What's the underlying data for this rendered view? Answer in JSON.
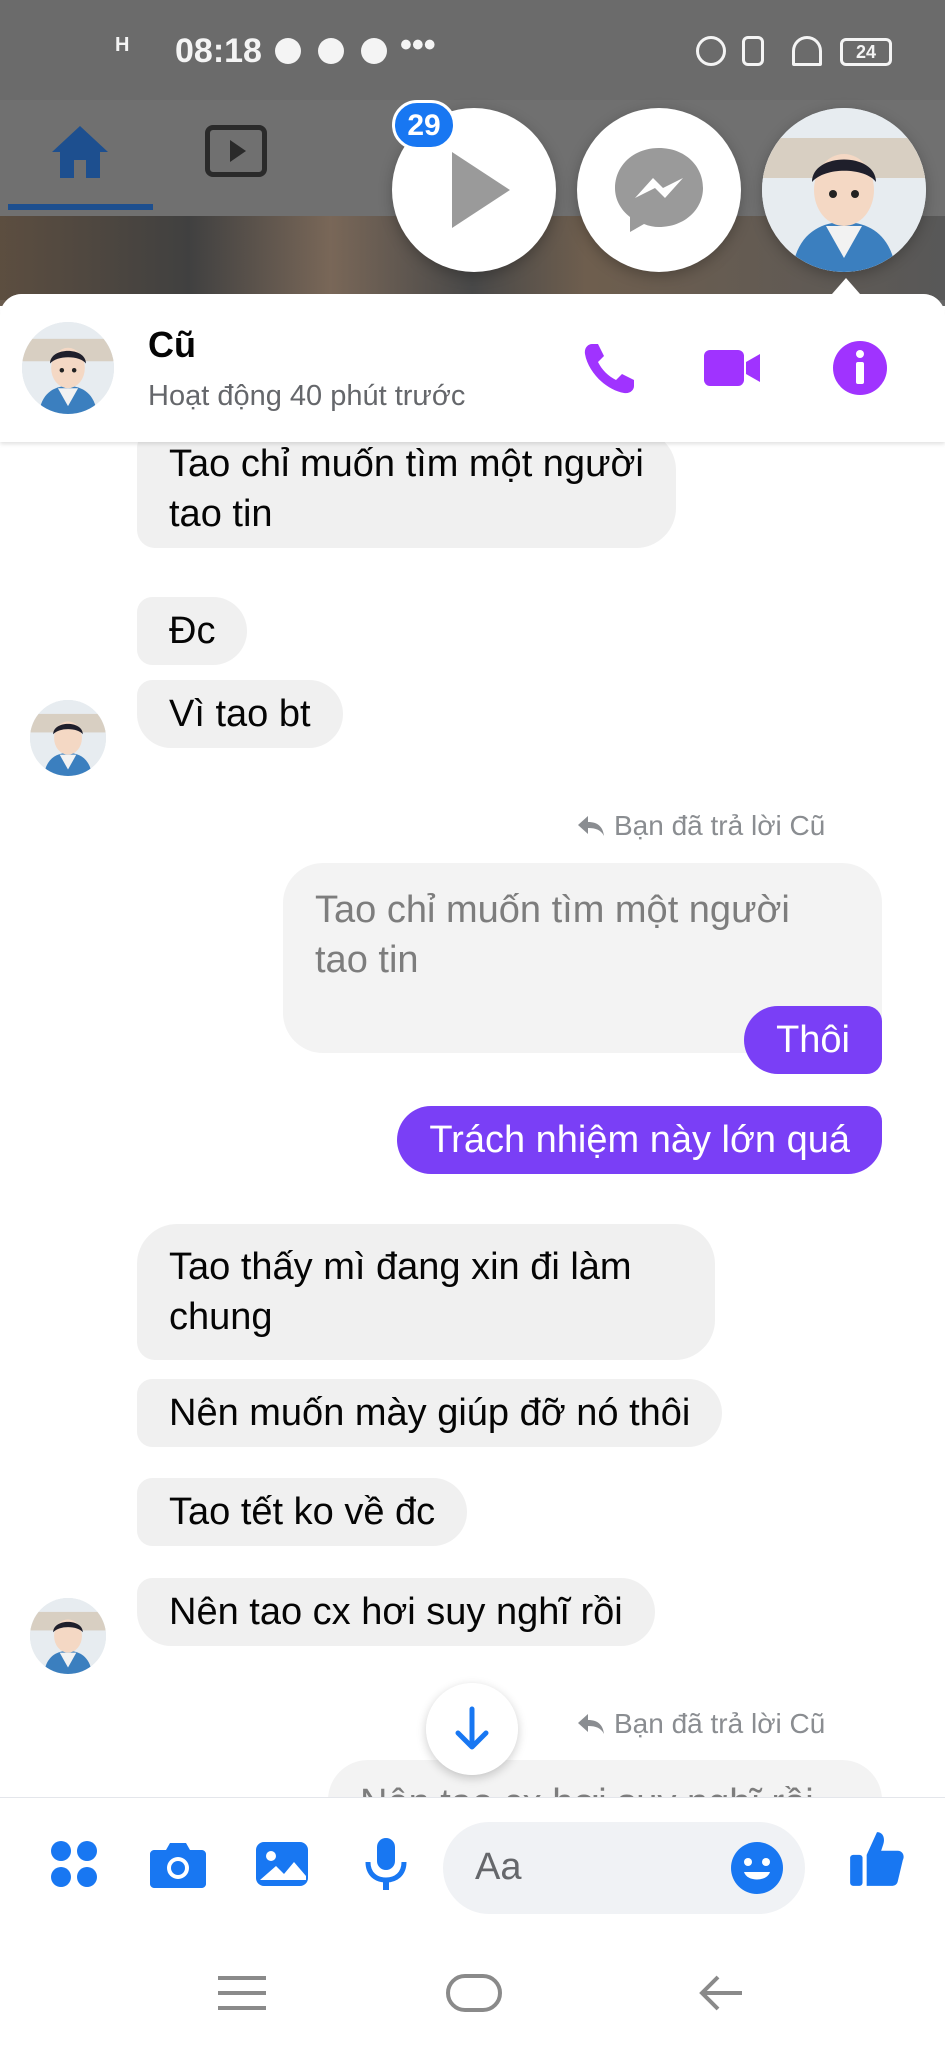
{
  "status_bar": {
    "network": "H",
    "time": "08:18",
    "more": "•••",
    "battery": "24"
  },
  "chat_heads": {
    "badge_count": "29"
  },
  "header": {
    "contact_name": "Cũ",
    "activity": "Hoạt động 40 phút trước"
  },
  "messages": [
    {
      "side": "in",
      "text": "Tao chỉ muốn tìm một người\ntao tin"
    },
    {
      "side": "in",
      "text": "Đc"
    },
    {
      "side": "in",
      "text": "Vì tao bt"
    },
    {
      "side": "note",
      "text": "Bạn đã trả lời Cũ"
    },
    {
      "side": "quoted",
      "text": "Tao chỉ muốn tìm một người\ntao tin"
    },
    {
      "side": "out",
      "text": "Thôi"
    },
    {
      "side": "out",
      "text": "Trách nhiệm này lớn quá"
    },
    {
      "side": "in",
      "text": "Tao thấy mì đang xin đi làm\nchung"
    },
    {
      "side": "in",
      "text": "Nên muốn mày giúp đỡ nó thôi"
    },
    {
      "side": "in",
      "text": "Tao tết ko về đc"
    },
    {
      "side": "in",
      "text": "Nên tao cx hơi suy nghĩ rồi"
    },
    {
      "side": "note",
      "text": "Bạn đã trả lời Cũ"
    },
    {
      "side": "quoted",
      "text": "Nên tao cx hơi suy nghĩ rồi"
    }
  ],
  "composer": {
    "placeholder": "Aa"
  },
  "colors": {
    "accent": "#7a3ff6",
    "icon_purple": "#a033ff",
    "messenger_blue": "#1877f2",
    "bubble_gray": "#f0f0f0"
  },
  "icons": [
    "home-icon",
    "video-tab-icon",
    "play-icon",
    "messenger-icon",
    "phone-icon",
    "video-call-icon",
    "info-icon",
    "reply-icon",
    "arrow-down-icon",
    "apps-icon",
    "camera-icon",
    "gallery-icon",
    "microphone-icon",
    "emoji-icon",
    "like-icon",
    "menu-icon",
    "home-nav-icon",
    "back-icon"
  ]
}
